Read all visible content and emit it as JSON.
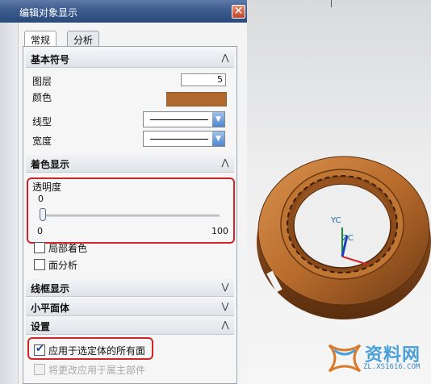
{
  "dialog": {
    "title": "编辑对象显示",
    "close_glyph": "✕",
    "tabs": [
      {
        "label": "常规"
      },
      {
        "label": "分析"
      }
    ]
  },
  "sections": {
    "basic": {
      "label": "基本符号",
      "chevron": "⋀"
    },
    "shading": {
      "label": "着色显示",
      "chevron": "⋀"
    },
    "wireframe": {
      "label": "线框显示",
      "chevron": "⋁"
    },
    "facet": {
      "label": "小平面体",
      "chevron": "⋁"
    },
    "settings": {
      "label": "设置",
      "chevron": "⋀"
    }
  },
  "basic": {
    "layer_label": "图层",
    "layer_value": "5",
    "color_label": "颜色",
    "color_value": "#b0682e",
    "linetype_label": "线型",
    "width_label": "宽度"
  },
  "shading": {
    "transparency_label": "透明度",
    "transparency_value": "0",
    "transparency_min": "0",
    "transparency_max": "100",
    "transparency_fraction": 0.0,
    "partial_shading_label": "局部着色",
    "face_analysis_label": "面分析"
  },
  "settings": {
    "apply_all_faces_label": "应用于选定体的所有面",
    "apply_all_faces_checked": true,
    "apply_to_owner_label": "将更改应用于属主部件",
    "apply_to_owner_checked": false
  },
  "viewport": {
    "triad": {
      "y_label": "YC",
      "z_label": "ZC"
    },
    "watermark": {
      "text": "资料网",
      "url": "ZL.XS1616.COM"
    }
  },
  "colors": {
    "part_body": "#b0682e",
    "highlight": "#d2232a",
    "titlebar": "#3c5b8e"
  }
}
